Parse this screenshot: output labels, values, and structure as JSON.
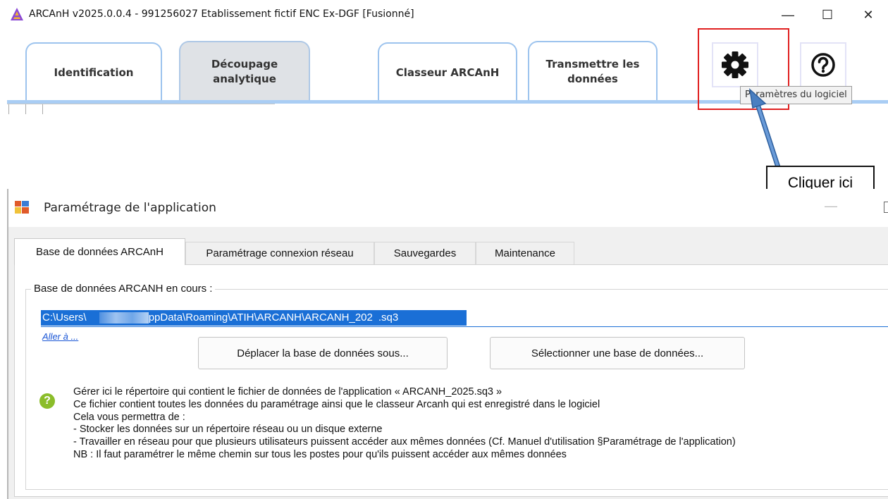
{
  "main_window": {
    "title": "ARCAnH v2025.0.0.4 - 991256027 Etablissement fictif ENC Ex-DGF [Fusionné]",
    "logo_letter": "A",
    "controls": {
      "minimize": "—",
      "maximize": "☐",
      "close": "✕"
    },
    "tabs": [
      {
        "label": "Identification",
        "active": false
      },
      {
        "label": "Découpage analytique",
        "active": true
      },
      {
        "label": "Classeur ARCAnH",
        "active": false
      },
      {
        "label": "Transmettre les données",
        "active": false
      }
    ],
    "settings_icon": "gear-icon",
    "help_icon": "question-circle-icon",
    "tooltip": "Paramètres du logiciel"
  },
  "annotation": {
    "callout": "Cliquer ici",
    "highlight_color": "#e02020",
    "arrow_color": "#4a7fc1"
  },
  "dialog": {
    "title": "Paramétrage de l'application",
    "tabs": [
      {
        "label": "Base de données ARCAnH",
        "active": true
      },
      {
        "label": "Paramétrage connexion réseau",
        "active": false
      },
      {
        "label": "Sauvegardes",
        "active": false
      },
      {
        "label": "Maintenance",
        "active": false
      }
    ],
    "group_title": "Base de données ARCANH en cours :",
    "path_prefix": "C:\\Users\\",
    "path_suffix": "\\AppData\\Roaming\\ATIH\\ARCANH\\ARCANH_202",
    "path_end": ".sq3",
    "goto_link": "Aller à ...",
    "buttons": {
      "move": "Déplacer la base de données sous...",
      "select": "Sélectionner une base de données..."
    },
    "help_lines": [
      "Gérer ici le répertoire qui contient le fichier de données de l'application « ARCANH_2025.sq3 »",
      "Ce fichier contient toutes les données du paramétrage ainsi que le classeur Arcanh qui est enregistré dans le logiciel",
      "Cela vous permettra de :",
      " - Stocker les données sur un répertoire réseau ou un disque externe",
      " - Travailler en réseau pour que plusieurs utilisateurs puissent accéder aux mêmes données (Cf. Manuel d'utilisation §Paramétrage de l'application)",
      "NB : Il faut paramétrer le même chemin sur tous les postes pour qu'ils puissent accéder aux mêmes données"
    ],
    "help_symbol": "?"
  }
}
